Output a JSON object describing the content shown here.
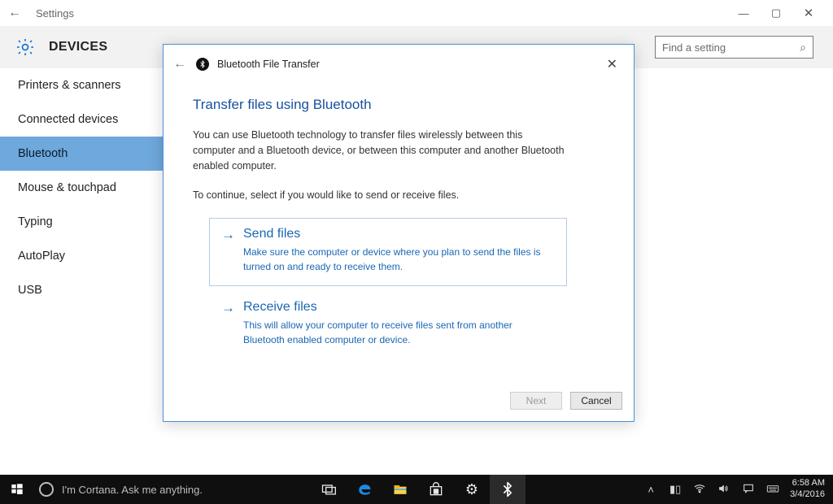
{
  "titlebar": {
    "label": "Settings"
  },
  "header": {
    "title": "DEVICES",
    "search_placeholder": "Find a setting"
  },
  "sidebar": {
    "items": [
      {
        "label": "Printers & scanners"
      },
      {
        "label": "Connected devices"
      },
      {
        "label": "Bluetooth"
      },
      {
        "label": "Mouse & touchpad"
      },
      {
        "label": "Typing"
      },
      {
        "label": "AutoPlay"
      },
      {
        "label": "USB"
      }
    ],
    "active_index": 2
  },
  "dialog": {
    "window_title": "Bluetooth File Transfer",
    "heading": "Transfer files using Bluetooth",
    "intro": "You can use Bluetooth technology to transfer files wirelessly between this computer and a Bluetooth device, or between this computer and another Bluetooth enabled computer.",
    "instruction": "To continue, select if you would like to send or receive files.",
    "options": [
      {
        "title": "Send files",
        "desc": "Make sure the computer or device where you plan to send the files is turned on and ready to receive them."
      },
      {
        "title": "Receive files",
        "desc": "This will allow your computer to receive files sent from another Bluetooth enabled computer or device."
      }
    ],
    "buttons": {
      "next": "Next",
      "cancel": "Cancel"
    }
  },
  "taskbar": {
    "cortana_placeholder": "I'm Cortana. Ask me anything.",
    "clock": {
      "time": "6:58 AM",
      "date": "3/4/2016"
    }
  }
}
